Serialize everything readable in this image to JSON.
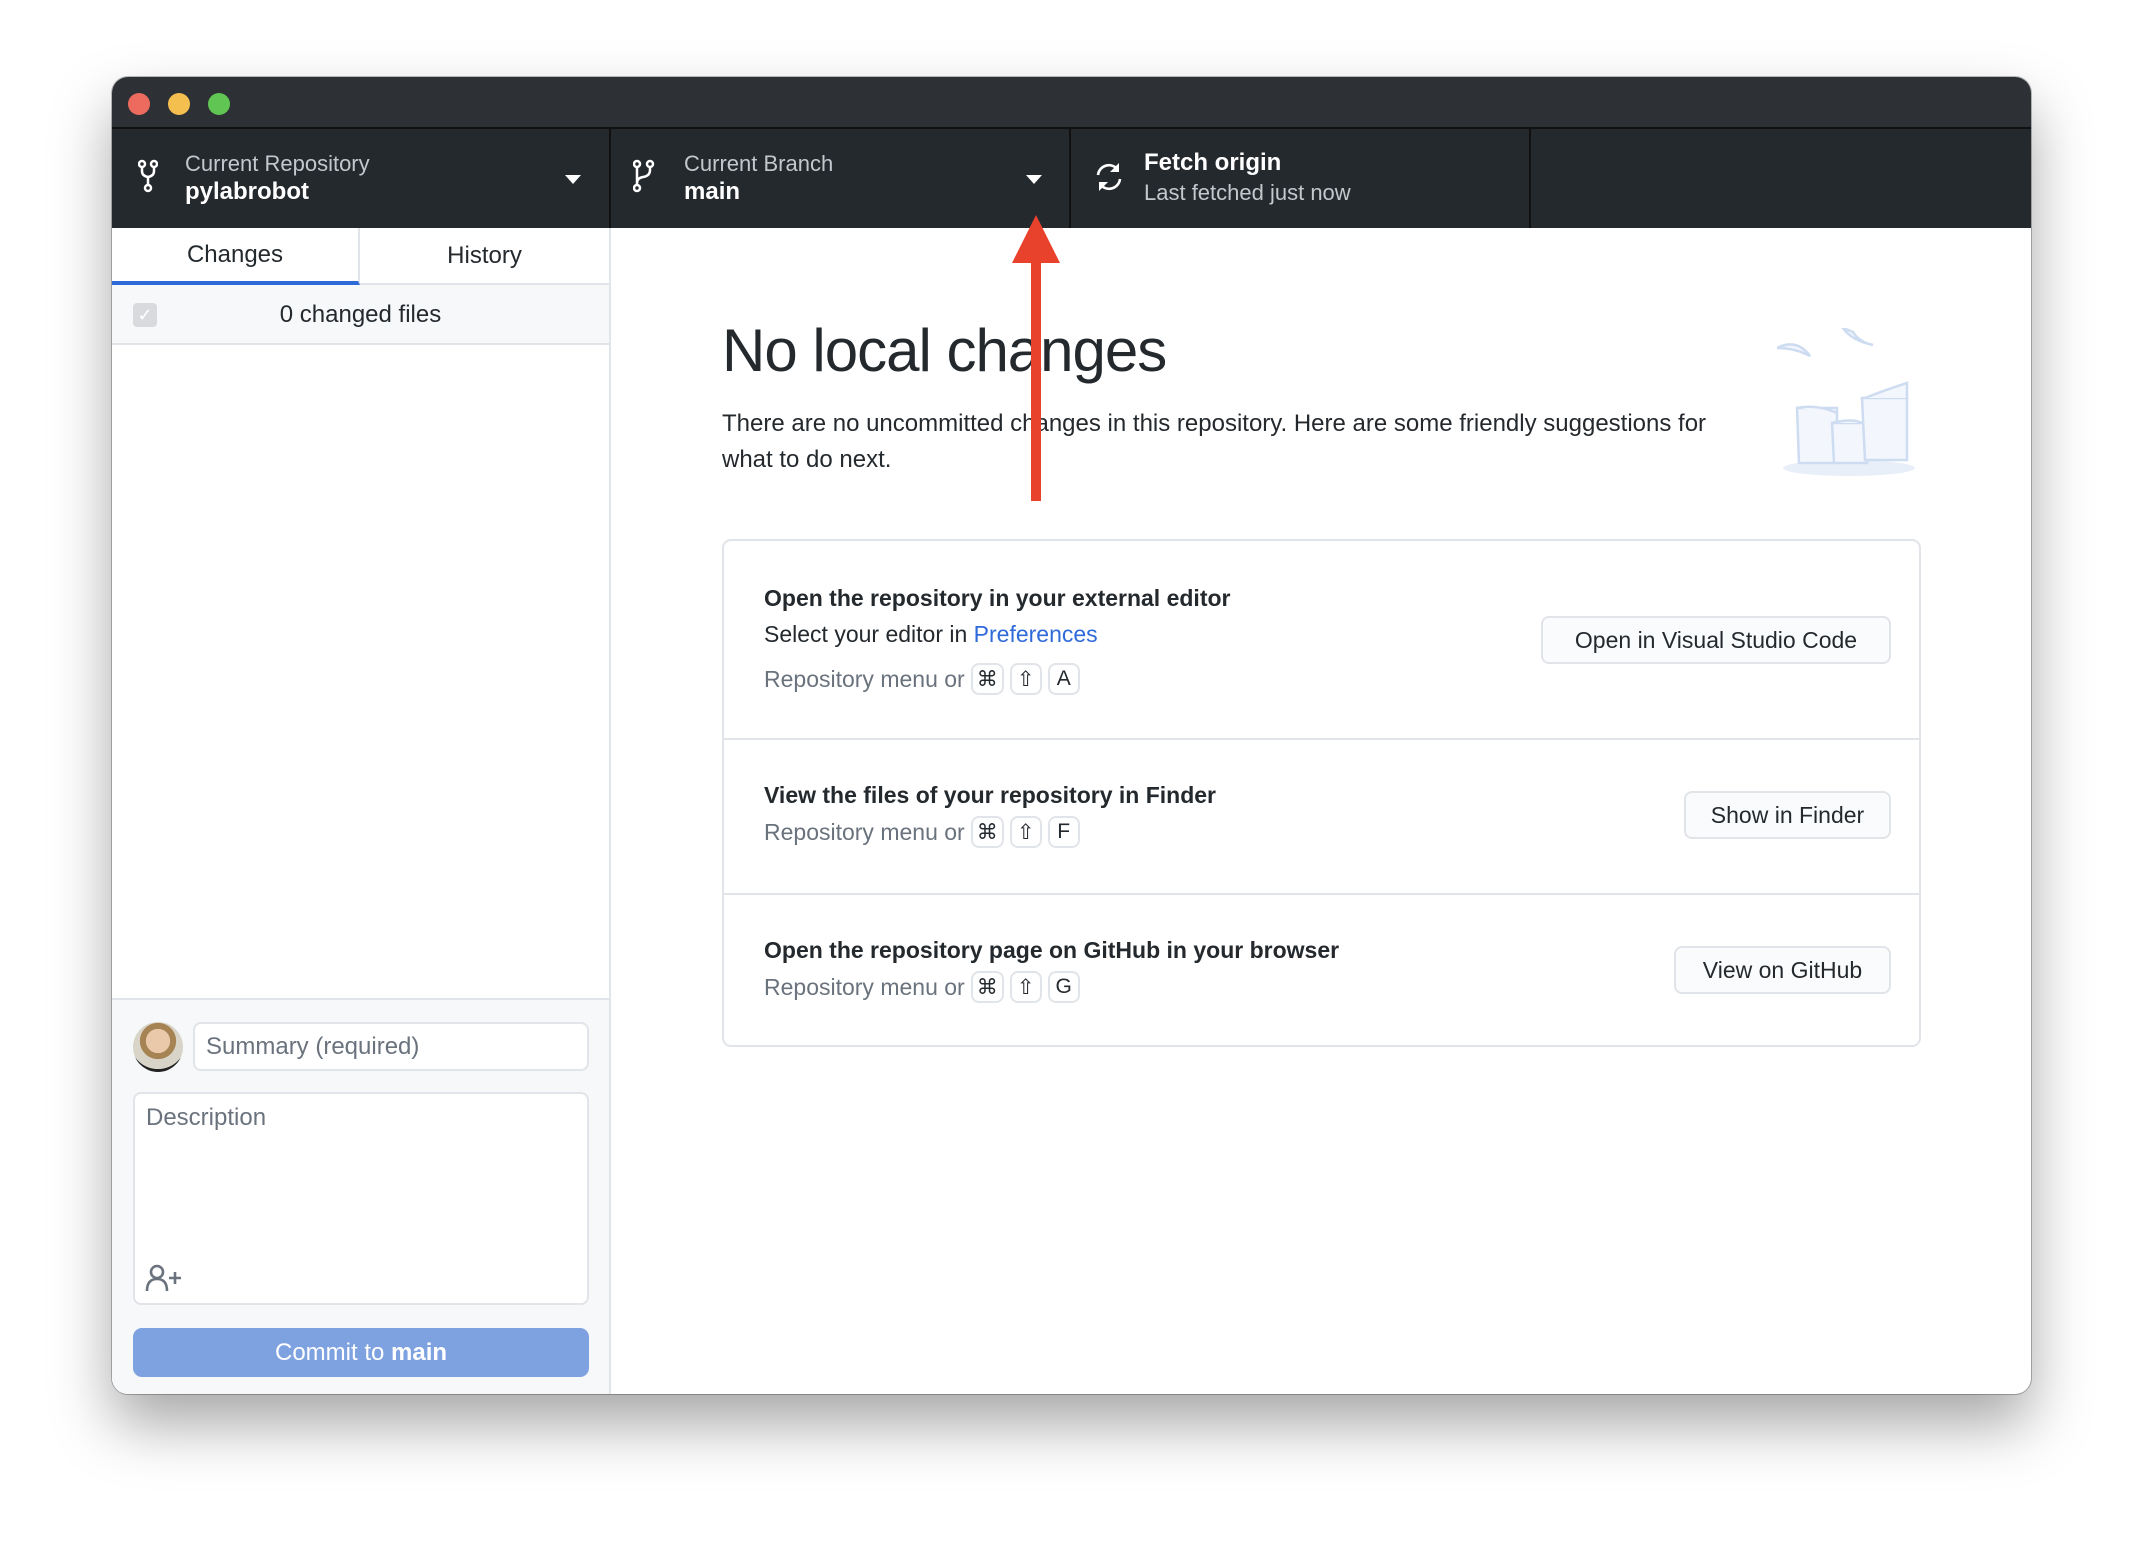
{
  "window": {
    "controls": [
      "close",
      "minimize",
      "zoom"
    ],
    "control_colors": {
      "close": "#ed6a5e",
      "minimize": "#f5bf4f",
      "zoom": "#61c554"
    }
  },
  "toolbar": {
    "repository": {
      "label": "Current Repository",
      "value": "pylabrobot",
      "icon": "repo-icon"
    },
    "branch": {
      "label": "Current Branch",
      "value": "main",
      "icon": "git-branch-icon"
    },
    "fetch": {
      "label": "Fetch origin",
      "status": "Last fetched just now",
      "icon": "sync-icon"
    }
  },
  "sidebar": {
    "tabs": [
      {
        "label": "Changes",
        "active": true
      },
      {
        "label": "History",
        "active": false
      }
    ],
    "changed_files": "0 changed files",
    "commit": {
      "summary_placeholder": "Summary (required)",
      "description_placeholder": "Description",
      "button_prefix": "Commit to ",
      "button_branch": "main"
    }
  },
  "main": {
    "title": "No local changes",
    "description": "There are no uncommitted changes in this repository. Here are some friendly suggestions for what to do next.",
    "suggestions": [
      {
        "title": "Open the repository in your external editor",
        "subtitle_prefix": "Select your editor in ",
        "subtitle_link": "Preferences",
        "hint": "Repository menu or",
        "keys": [
          "⌘",
          "⇧",
          "A"
        ],
        "button": "Open in Visual Studio Code"
      },
      {
        "title": "View the files of your repository in Finder",
        "hint": "Repository menu or",
        "keys": [
          "⌘",
          "⇧",
          "F"
        ],
        "button": "Show in Finder"
      },
      {
        "title": "Open the repository page on GitHub in your browser",
        "hint": "Repository menu or",
        "keys": [
          "⌘",
          "⇧",
          "G"
        ],
        "button": "View on GitHub"
      }
    ]
  },
  "colors": {
    "accent": "#2f6ad9",
    "link": "#0366d6",
    "commit_button": "#7ea1e0",
    "toolbar": "#24292e",
    "annotation_arrow": "#e8412c"
  }
}
